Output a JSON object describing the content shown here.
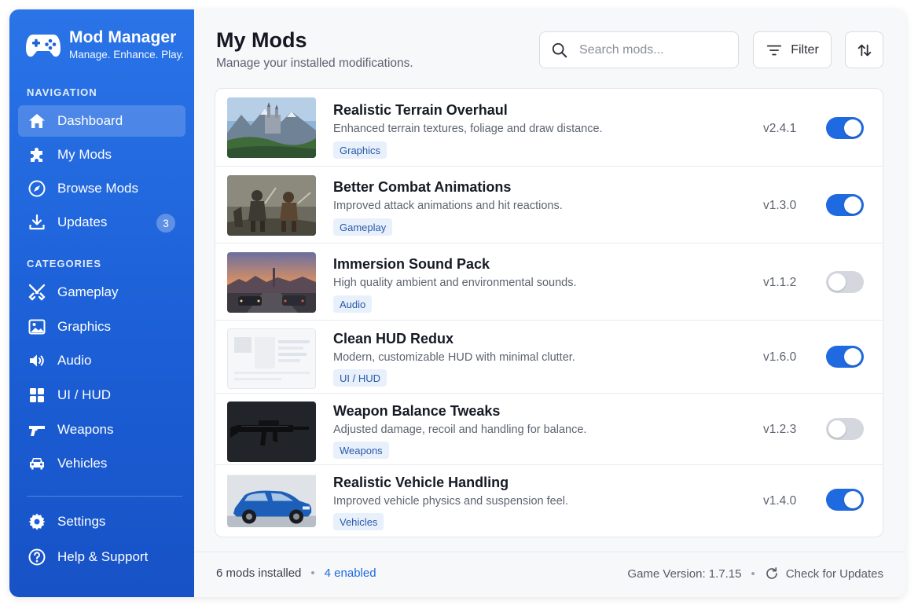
{
  "brand": {
    "title": "Mod Manager",
    "subtitle": "Manage. Enhance. Play."
  },
  "sidebar": {
    "navigation_label": "NAVIGATION",
    "nav": [
      {
        "label": "Dashboard",
        "icon": "home-icon",
        "active": true
      },
      {
        "label": "My Mods",
        "icon": "puzzle-icon"
      },
      {
        "label": "Browse Mods",
        "icon": "compass-icon"
      },
      {
        "label": "Updates",
        "icon": "download-icon",
        "badge": "3"
      }
    ],
    "categories_label": "CATEGORIES",
    "categories": [
      {
        "label": "Gameplay",
        "icon": "crossed-swords-icon"
      },
      {
        "label": "Graphics",
        "icon": "image-icon"
      },
      {
        "label": "Audio",
        "icon": "speaker-icon"
      },
      {
        "label": "UI / HUD",
        "icon": "grid-icon"
      },
      {
        "label": "Weapons",
        "icon": "gun-icon"
      },
      {
        "label": "Vehicles",
        "icon": "car-icon"
      }
    ],
    "bottom": [
      {
        "label": "Settings",
        "icon": "gear-icon"
      },
      {
        "label": "Help & Support",
        "icon": "help-icon"
      }
    ]
  },
  "header": {
    "title": "My Mods",
    "subtitle": "Manage your installed modifications.",
    "search_placeholder": "Search mods...",
    "filter_label": "Filter"
  },
  "mods": [
    {
      "title": "Realistic Terrain Overhaul",
      "desc": "Enhanced terrain textures, foliage and draw distance.",
      "tag": "Graphics",
      "version": "v2.4.1",
      "enabled": true,
      "thumb": "mountain-castle"
    },
    {
      "title": "Better Combat Animations",
      "desc": "Improved attack animations and hit reactions.",
      "tag": "Gameplay",
      "version": "v1.3.0",
      "enabled": true,
      "thumb": "warriors"
    },
    {
      "title": "Immersion Sound Pack",
      "desc": "High quality ambient and environmental sounds.",
      "tag": "Audio",
      "version": "v1.1.2",
      "enabled": false,
      "thumb": "sunset-road"
    },
    {
      "title": "Clean HUD Redux",
      "desc": "Modern, customizable HUD with minimal clutter.",
      "tag": "UI / HUD",
      "version": "v1.6.0",
      "enabled": true,
      "thumb": "hud-mockup"
    },
    {
      "title": "Weapon Balance Tweaks",
      "desc": "Adjusted damage, recoil and handling for balance.",
      "tag": "Weapons",
      "version": "v1.2.3",
      "enabled": false,
      "thumb": "rifle"
    },
    {
      "title": "Realistic Vehicle Handling",
      "desc": "Improved vehicle physics and suspension feel.",
      "tag": "Vehicles",
      "version": "v1.4.0",
      "enabled": true,
      "thumb": "blue-car"
    }
  ],
  "footer": {
    "installed": "6 mods installed",
    "enabled": "4 enabled",
    "game_version": "Game Version: 1.7.15",
    "check_updates": "Check for Updates"
  },
  "colors": {
    "accent": "#1f6ae0",
    "sidebar": "#1c5fd6"
  }
}
